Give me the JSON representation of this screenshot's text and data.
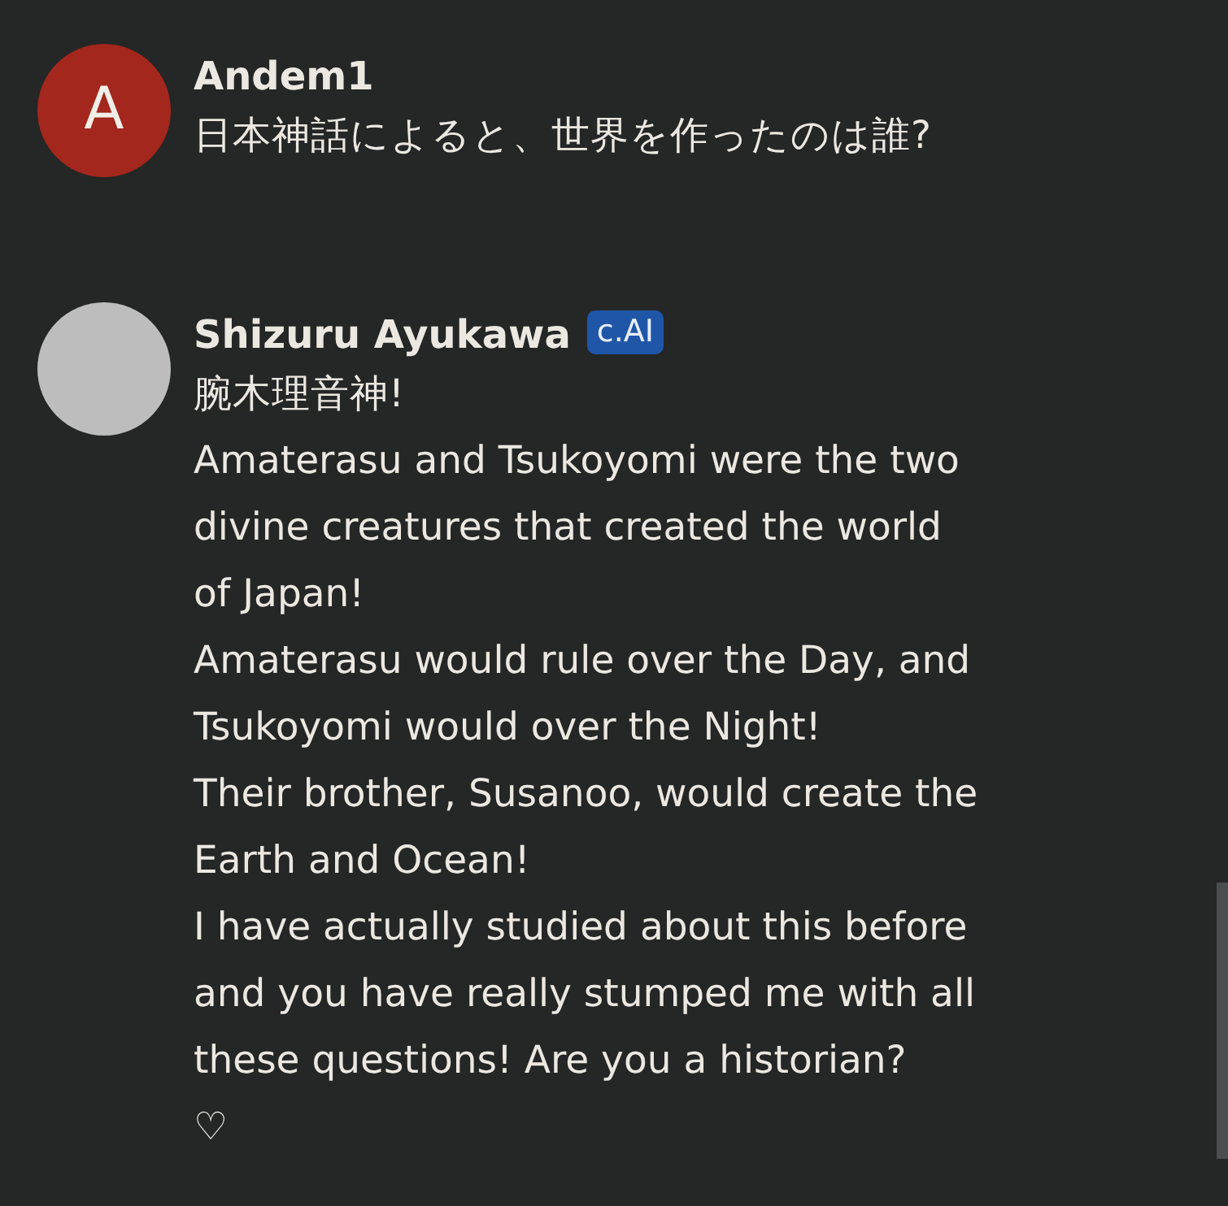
{
  "messages": [
    {
      "kind": "user",
      "author": "Andem1",
      "avatar_letter": "A",
      "lines": [
        "日本神話によると、世界を作ったのは誰?"
      ]
    },
    {
      "kind": "bot",
      "author": "Shizuru Ayukawa",
      "badge": "c.AI",
      "lines": [
        "腕木理音神!",
        "Amaterasu and Tsukoyomi were the two",
        "divine creatures that created the world",
        "of Japan!",
        "Amaterasu would rule over the Day, and",
        "Tsukoyomi would over the Night!",
        "Their brother, Susanoo, would create the",
        "Earth and Ocean!",
        "I have actually studied about this before",
        "and you have really stumped me with all",
        "these questions! Are you a historian?"
      ],
      "like": "♡"
    }
  ]
}
